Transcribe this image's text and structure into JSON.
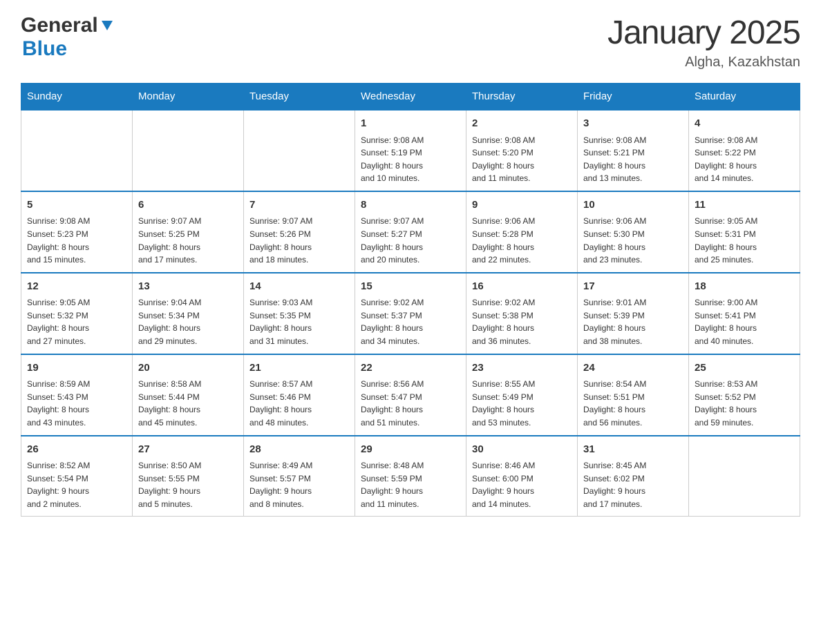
{
  "logo": {
    "general": "General",
    "blue": "Blue"
  },
  "header": {
    "title": "January 2025",
    "subtitle": "Algha, Kazakhstan"
  },
  "days_of_week": [
    "Sunday",
    "Monday",
    "Tuesday",
    "Wednesday",
    "Thursday",
    "Friday",
    "Saturday"
  ],
  "weeks": [
    [
      {
        "day": "",
        "info": ""
      },
      {
        "day": "",
        "info": ""
      },
      {
        "day": "",
        "info": ""
      },
      {
        "day": "1",
        "info": "Sunrise: 9:08 AM\nSunset: 5:19 PM\nDaylight: 8 hours\nand 10 minutes."
      },
      {
        "day": "2",
        "info": "Sunrise: 9:08 AM\nSunset: 5:20 PM\nDaylight: 8 hours\nand 11 minutes."
      },
      {
        "day": "3",
        "info": "Sunrise: 9:08 AM\nSunset: 5:21 PM\nDaylight: 8 hours\nand 13 minutes."
      },
      {
        "day": "4",
        "info": "Sunrise: 9:08 AM\nSunset: 5:22 PM\nDaylight: 8 hours\nand 14 minutes."
      }
    ],
    [
      {
        "day": "5",
        "info": "Sunrise: 9:08 AM\nSunset: 5:23 PM\nDaylight: 8 hours\nand 15 minutes."
      },
      {
        "day": "6",
        "info": "Sunrise: 9:07 AM\nSunset: 5:25 PM\nDaylight: 8 hours\nand 17 minutes."
      },
      {
        "day": "7",
        "info": "Sunrise: 9:07 AM\nSunset: 5:26 PM\nDaylight: 8 hours\nand 18 minutes."
      },
      {
        "day": "8",
        "info": "Sunrise: 9:07 AM\nSunset: 5:27 PM\nDaylight: 8 hours\nand 20 minutes."
      },
      {
        "day": "9",
        "info": "Sunrise: 9:06 AM\nSunset: 5:28 PM\nDaylight: 8 hours\nand 22 minutes."
      },
      {
        "day": "10",
        "info": "Sunrise: 9:06 AM\nSunset: 5:30 PM\nDaylight: 8 hours\nand 23 minutes."
      },
      {
        "day": "11",
        "info": "Sunrise: 9:05 AM\nSunset: 5:31 PM\nDaylight: 8 hours\nand 25 minutes."
      }
    ],
    [
      {
        "day": "12",
        "info": "Sunrise: 9:05 AM\nSunset: 5:32 PM\nDaylight: 8 hours\nand 27 minutes."
      },
      {
        "day": "13",
        "info": "Sunrise: 9:04 AM\nSunset: 5:34 PM\nDaylight: 8 hours\nand 29 minutes."
      },
      {
        "day": "14",
        "info": "Sunrise: 9:03 AM\nSunset: 5:35 PM\nDaylight: 8 hours\nand 31 minutes."
      },
      {
        "day": "15",
        "info": "Sunrise: 9:02 AM\nSunset: 5:37 PM\nDaylight: 8 hours\nand 34 minutes."
      },
      {
        "day": "16",
        "info": "Sunrise: 9:02 AM\nSunset: 5:38 PM\nDaylight: 8 hours\nand 36 minutes."
      },
      {
        "day": "17",
        "info": "Sunrise: 9:01 AM\nSunset: 5:39 PM\nDaylight: 8 hours\nand 38 minutes."
      },
      {
        "day": "18",
        "info": "Sunrise: 9:00 AM\nSunset: 5:41 PM\nDaylight: 8 hours\nand 40 minutes."
      }
    ],
    [
      {
        "day": "19",
        "info": "Sunrise: 8:59 AM\nSunset: 5:43 PM\nDaylight: 8 hours\nand 43 minutes."
      },
      {
        "day": "20",
        "info": "Sunrise: 8:58 AM\nSunset: 5:44 PM\nDaylight: 8 hours\nand 45 minutes."
      },
      {
        "day": "21",
        "info": "Sunrise: 8:57 AM\nSunset: 5:46 PM\nDaylight: 8 hours\nand 48 minutes."
      },
      {
        "day": "22",
        "info": "Sunrise: 8:56 AM\nSunset: 5:47 PM\nDaylight: 8 hours\nand 51 minutes."
      },
      {
        "day": "23",
        "info": "Sunrise: 8:55 AM\nSunset: 5:49 PM\nDaylight: 8 hours\nand 53 minutes."
      },
      {
        "day": "24",
        "info": "Sunrise: 8:54 AM\nSunset: 5:51 PM\nDaylight: 8 hours\nand 56 minutes."
      },
      {
        "day": "25",
        "info": "Sunrise: 8:53 AM\nSunset: 5:52 PM\nDaylight: 8 hours\nand 59 minutes."
      }
    ],
    [
      {
        "day": "26",
        "info": "Sunrise: 8:52 AM\nSunset: 5:54 PM\nDaylight: 9 hours\nand 2 minutes."
      },
      {
        "day": "27",
        "info": "Sunrise: 8:50 AM\nSunset: 5:55 PM\nDaylight: 9 hours\nand 5 minutes."
      },
      {
        "day": "28",
        "info": "Sunrise: 8:49 AM\nSunset: 5:57 PM\nDaylight: 9 hours\nand 8 minutes."
      },
      {
        "day": "29",
        "info": "Sunrise: 8:48 AM\nSunset: 5:59 PM\nDaylight: 9 hours\nand 11 minutes."
      },
      {
        "day": "30",
        "info": "Sunrise: 8:46 AM\nSunset: 6:00 PM\nDaylight: 9 hours\nand 14 minutes."
      },
      {
        "day": "31",
        "info": "Sunrise: 8:45 AM\nSunset: 6:02 PM\nDaylight: 9 hours\nand 17 minutes."
      },
      {
        "day": "",
        "info": ""
      }
    ]
  ]
}
